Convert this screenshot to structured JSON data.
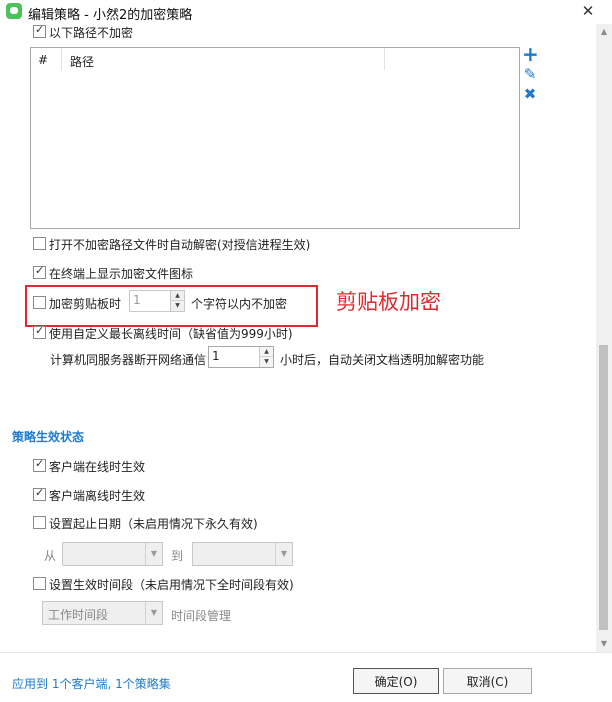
{
  "window": {
    "title": "编辑策略 - 小然2的加密策略",
    "close": "✕"
  },
  "exclude_paths": {
    "checkbox_label": "以下路径不加密",
    "checked": true,
    "columns": [
      "#",
      "路径"
    ],
    "add_icon": "+",
    "edit_icon": "✎",
    "delete_icon": "✖"
  },
  "options": {
    "auto_decrypt": {
      "label": "打开不加密路径文件时自动解密(对授信进程生效)",
      "checked": false
    },
    "show_icon": {
      "label": "在终端上显示加密文件图标",
      "checked": true
    },
    "clipboard": {
      "label": "加密剪贴板时",
      "value": "1",
      "suffix": "个字符以内不加密",
      "checked": false
    },
    "offline": {
      "label": "使用自定义最长离线时间（缺省值为999小时)",
      "checked": true
    },
    "offline_detail": {
      "prefix": "计算机同服务器断开网络通信",
      "value": "1",
      "suffix": "小时后，自动关闭文档透明加解密功能"
    }
  },
  "annotation": "剪贴板加密",
  "status": {
    "title": "策略生效状态",
    "online": {
      "label": "客户端在线时生效",
      "checked": true
    },
    "offline": {
      "label": "客户端离线时生效",
      "checked": true
    },
    "date_range": {
      "label": "设置起止日期（未启用情况下永久有效)",
      "checked": false,
      "from": "从",
      "to": "到"
    },
    "time_period": {
      "label": "设置生效时间段（未启用情况下全时间段有效)",
      "checked": false,
      "select_value": "工作时间段",
      "manage_link": "时间段管理"
    }
  },
  "footer": {
    "apply_info": "应用到 1个客户端, 1个策略集",
    "ok": "确定(O)",
    "cancel": "取消(C)"
  },
  "colors": {
    "accent": "#1e7ad0",
    "annotation": "#e0282e",
    "app_icon": "#4cc25a"
  }
}
